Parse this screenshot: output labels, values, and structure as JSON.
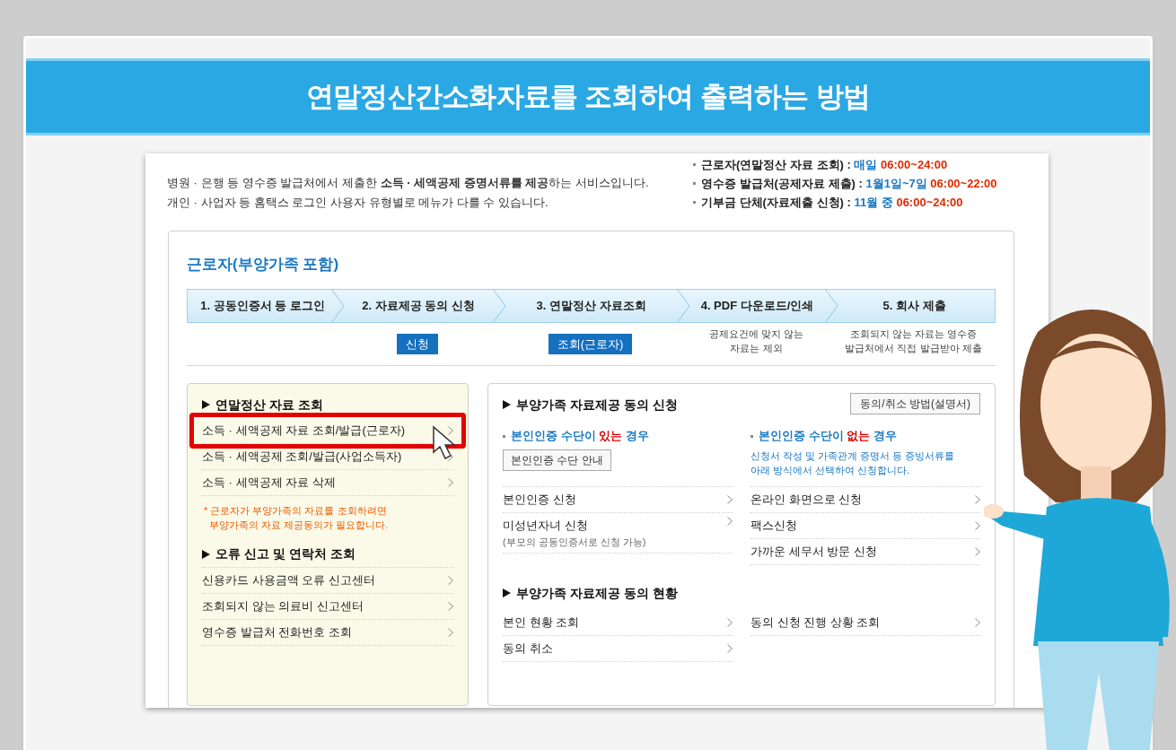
{
  "title": "연말정산간소화자료를 조회하여 출력하는 방법",
  "intro": [
    "병원 · 은행 등 영수증 발급처에서 제출한 **소득 · 세액공제 증명서류를 제공**하는 서비스입니다.",
    "개인 · 사업자 등 홈택스 로그인 사용자 유형별로 메뉴가 다를 수 있습니다."
  ],
  "schedule": [
    {
      "label": "근로자(연말정산 자료 조회) :",
      "when": "매일",
      "time": "06:00~24:00"
    },
    {
      "label": "영수증 발급처(공제자료 제출) :",
      "when": "1월1일~7일",
      "time": "06:00~22:00"
    },
    {
      "label": "기부금 단체(자료제출 신청) :",
      "when": "11월 중",
      "time": "06:00~24:00"
    }
  ],
  "section_title": "근로자(부양가족 포함)",
  "steps": [
    {
      "label": "1. 공동인증서 등 로그인"
    },
    {
      "label": "2. 자료제공 동의 신청",
      "button": "신청"
    },
    {
      "label": "3. 연말정산 자료조회",
      "button": "조회(근로자)"
    },
    {
      "label": "4. PDF 다운로드/인쇄",
      "note": [
        "공제요건에 맞지 않는",
        "자료는 제외"
      ]
    },
    {
      "label": "5. 회사 제출",
      "note": [
        "조회되지 않는 자료는 영수증",
        "발급처에서 직접 발급받아 제출"
      ]
    }
  ],
  "left_panel": [
    {
      "heading": "연말정산 자료 조회",
      "items": [
        {
          "label": "소득 · 세액공제 자료 조회/발급(근로자)",
          "highlighted": true
        },
        {
          "label": "소득 · 세액공제 조회/발급(사업소득자)",
          "highlighted": false
        },
        {
          "label": "소득 · 세액공제 자료 삭제",
          "highlighted": false
        }
      ],
      "notice": [
        "* 근로자가 부양가족의 자료를 조회하려면",
        "부양가족의 자료 제공동의가 필요합니다."
      ]
    },
    {
      "heading": "오류 신고 및 연락처 조회",
      "items": [
        {
          "label": "신용카드 사용금액 오류 신고센터",
          "highlighted": false
        },
        {
          "label": "조회되지 않는 의료비 신고센터",
          "highlighted": false
        },
        {
          "label": "영수증 발급처 전화번호 조회",
          "highlighted": false
        }
      ]
    }
  ],
  "right_panel": {
    "heading": "부양가족 자료제공 동의 신청",
    "guide_button": "동의/취소 방법(설명서)",
    "columns": [
      {
        "heading": {
          "before": "본인인증 수단이 ",
          "emphasis": "있는",
          "after": " 경우"
        },
        "button": "본인인증 수단 안내",
        "items": [
          {
            "label": "본인인증 신청"
          },
          {
            "label": "미성년자녀 신청",
            "sub": "(부모의 공동인증서로 신청 가능)"
          }
        ]
      },
      {
        "heading": {
          "before": "본인인증 수단이 ",
          "emphasis": "없는",
          "after": " 경우"
        },
        "description": [
          "신청서 작성 및 가족관계 증명서 등 증빙서류를",
          "아래 방식에서 선택하여 신청합니다."
        ],
        "items": [
          {
            "label": "온라인 화면으로 신청"
          },
          {
            "label": "팩스신청"
          },
          {
            "label": "가까운 세무서 방문 신청"
          }
        ]
      }
    ],
    "status_heading": "부양가족 자료제공 동의 현황",
    "status_columns": [
      [
        {
          "label": "본인 현황 조회"
        },
        {
          "label": "동의 취소"
        }
      ],
      [
        {
          "label": "동의 신청 진행 상황 조회"
        }
      ]
    ]
  }
}
